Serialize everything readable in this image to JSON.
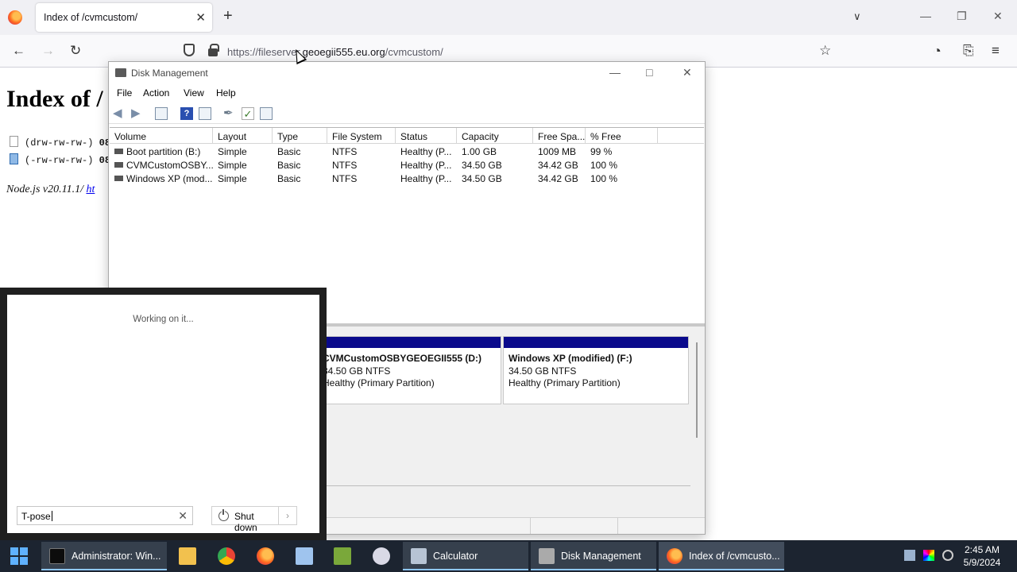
{
  "browser": {
    "tab_title": "Index of /cvmcustom/",
    "tab_close": "✕",
    "new_tab": "+",
    "url_prefix": "https://fileserver.",
    "url_domain": "geoegii555.eu.org",
    "url_path": "/cvmcustom/",
    "icons": [
      "back-icon",
      "forward-icon",
      "reload-icon",
      "shield-icon",
      "lock-icon",
      "bookmark-star-icon",
      "account-icon",
      "extensions-icon",
      "menu-icon"
    ]
  },
  "page": {
    "heading": "Index of /",
    "rows": [
      {
        "perm": "(drw-rw-rw-)",
        "trail": "08"
      },
      {
        "perm": "(-rw-rw-rw-)",
        "trail": "08"
      }
    ],
    "footer_text": "Node.js v20.11.1/ ",
    "footer_link": "ht"
  },
  "disk_management": {
    "title": "Disk Management",
    "menu": [
      "File",
      "Action",
      "View",
      "Help"
    ],
    "columns": [
      "Volume",
      "Layout",
      "Type",
      "File System",
      "Status",
      "Capacity",
      "Free Spa...",
      "% Free"
    ],
    "volumes": [
      {
        "volume": "Boot partition (B:)",
        "layout": "Simple",
        "type": "Basic",
        "fs": "NTFS",
        "status": "Healthy (P...",
        "capacity": "1.00 GB",
        "free": "1009 MB",
        "pct": "99 %"
      },
      {
        "volume": "CVMCustomOSBY...",
        "layout": "Simple",
        "type": "Basic",
        "fs": "NTFS",
        "status": "Healthy (P...",
        "capacity": "34.50 GB",
        "free": "34.42 GB",
        "pct": "100 %"
      },
      {
        "volume": "Windows XP (mod...",
        "layout": "Simple",
        "type": "Basic",
        "fs": "NTFS",
        "status": "Healthy (P...",
        "capacity": "34.50 GB",
        "free": "34.42 GB",
        "pct": "100 %"
      }
    ],
    "partitions": [
      {
        "name": "CVMCustomOSBYGEOEGII555  (D:)",
        "size": "34.50 GB NTFS",
        "status": "Healthy (Primary Partition)"
      },
      {
        "name": "Windows XP (modified)  (F:)",
        "size": "34.50 GB NTFS",
        "status": "Healthy (Primary Partition)"
      }
    ],
    "partition_bar_color": "#0a0a8c"
  },
  "start_menu": {
    "working_text": "Working on it...",
    "search_value": "T-pose",
    "shutdown_label": "Shut down"
  },
  "taskbar": {
    "items": [
      {
        "label": "Administrator: Win..."
      },
      {
        "label": "Calculator"
      },
      {
        "label": "Disk Management"
      },
      {
        "label": "Index of /cvmcusto..."
      }
    ],
    "time": "2:45 AM",
    "date": "5/9/2024",
    "accent": "#8fc7ff"
  }
}
